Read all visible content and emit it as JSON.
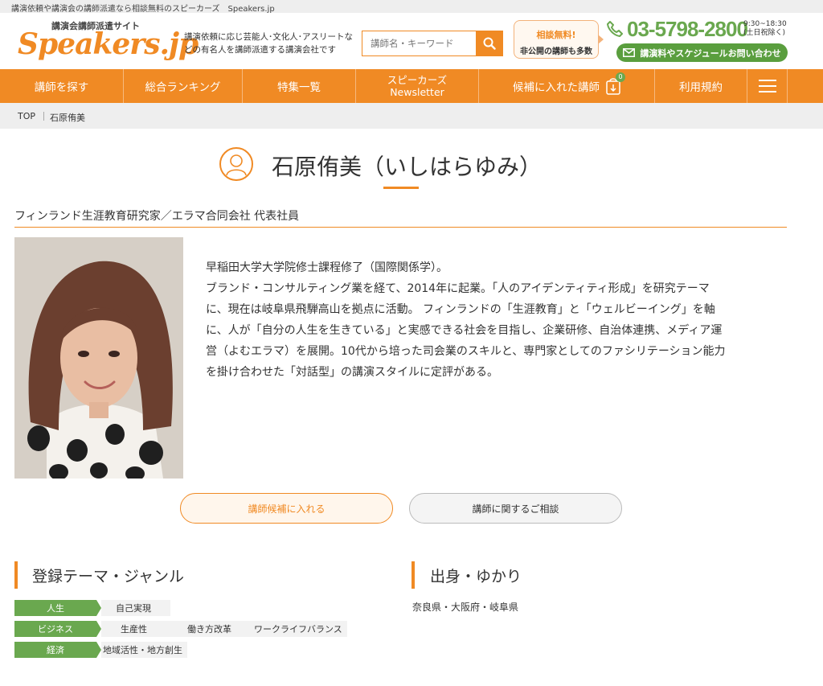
{
  "top_strip": {
    "text": "講演依頼や講演会の講師派遣なら相談無料のスピーカーズ　Speakers.jp"
  },
  "header": {
    "logo_sub": "講演会講師派遣サイト",
    "logo_main": "Speakers.jp",
    "tagline": "講演依頼に応じ芸能人･文化人･アスリートなどの有名人を講師派遣する講演会社です",
    "search_placeholder": "講師名・キーワード",
    "consult_line1": "相談無料!",
    "consult_line2": "非公開の講師も多数",
    "phone": "03-5798-2800",
    "hours_line1": "9:30~18:30",
    "hours_line2": "(土日祝除く)",
    "contact_label": "講演料やスケジュールお問い合わせ"
  },
  "nav": {
    "items": [
      {
        "label": "講師を探す"
      },
      {
        "label": "総合ランキング"
      },
      {
        "label": "特集一覧"
      },
      {
        "label_line1": "スピーカーズ",
        "label_line2": "Newsletter"
      },
      {
        "label": "候補に入れた講師",
        "badge": "0"
      },
      {
        "label": "利用規約"
      }
    ]
  },
  "breadcrumb": {
    "home": "TOP",
    "current": "石原侑美"
  },
  "speaker": {
    "name": "石原侑美（いしはらゆみ）",
    "role": "フィンランド生涯教育研究家／エラマ合同会社 代表社員",
    "bio_lines": [
      "早稲田大学大学院修士課程修了（国際関係学）。",
      "ブランド・コンサルティング業を経て、2014年に起業。「人のアイデンティティ形成」を研究テーマ",
      "に、現在は岐阜県飛騨高山を拠点に活動。 フィンランドの「生涯教育」と「ウェルビーイング」を軸",
      "に、人が「自分の人生を生きている」と実感できる社会を目指し、企業研修、自治体連携、メディア運",
      "営（よむエラマ）を展開。10代から培った司会業のスキルと、専門家としてのファシリテーション能力",
      "を掛け合わせた「対話型」の講演スタイルに定評がある。"
    ]
  },
  "buttons": {
    "add_candidate": "講師候補に入れる",
    "consult": "講師に関するご相談"
  },
  "sections": {
    "themes_title": "登録テーマ・ジャンル",
    "origin_title": "出身・ゆかり",
    "origin_value": "奈良県・大阪府・岐阜県"
  },
  "genres": [
    {
      "label": "人生",
      "tags": [
        "自己実現"
      ]
    },
    {
      "label": "ビジネス",
      "tags": [
        "生産性",
        "働き方改革",
        "ワークライフバランス"
      ]
    },
    {
      "label": "経済",
      "tags": [
        "地域活性・地方創生"
      ]
    }
  ],
  "colors": {
    "accent": "#f08a24",
    "green": "#6aa84f"
  }
}
